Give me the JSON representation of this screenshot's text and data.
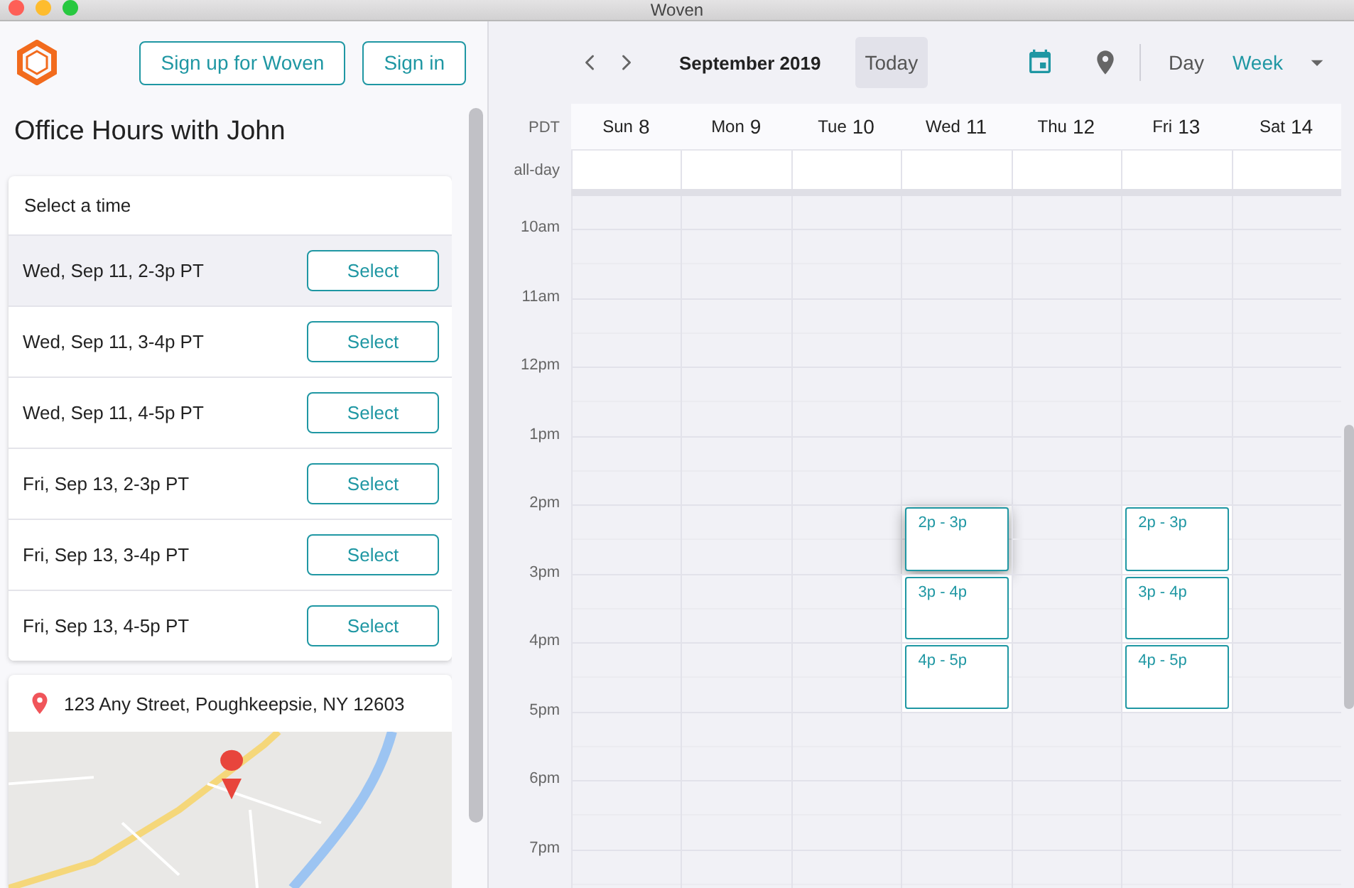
{
  "window": {
    "title": "Woven"
  },
  "header": {
    "buttons": [
      {
        "label": "Sign up for Woven"
      },
      {
        "label": "Sign in"
      }
    ]
  },
  "page_title": "Office Hours with John",
  "time_picker": {
    "heading": "Select a time",
    "slots": [
      {
        "label": "Wed, Sep 11, 2-3p PT",
        "button": "Select",
        "hovered": true
      },
      {
        "label": "Wed, Sep 11, 3-4p PT",
        "button": "Select",
        "hovered": false
      },
      {
        "label": "Wed, Sep 11, 4-5p PT",
        "button": "Select",
        "hovered": false
      },
      {
        "label": "Fri, Sep 13, 2-3p PT",
        "button": "Select",
        "hovered": false
      },
      {
        "label": "Fri, Sep 13, 3-4p PT",
        "button": "Select",
        "hovered": false
      },
      {
        "label": "Fri, Sep 13, 4-5p PT",
        "button": "Select",
        "hovered": false
      }
    ]
  },
  "location": {
    "address": "123 Any Street, Poughkeepsie, NY 12603"
  },
  "calendar": {
    "month": "September 2019",
    "today": "Today",
    "views": [
      {
        "label": "Day",
        "selected": false
      },
      {
        "label": "Week",
        "selected": true
      }
    ],
    "timezone": "PDT",
    "allday_label": "all-day",
    "days": [
      {
        "weekday": "Sun",
        "date": "8"
      },
      {
        "weekday": "Mon",
        "date": "9"
      },
      {
        "weekday": "Tue",
        "date": "10"
      },
      {
        "weekday": "Wed",
        "date": "11"
      },
      {
        "weekday": "Thu",
        "date": "12"
      },
      {
        "weekday": "Fri",
        "date": "13"
      },
      {
        "weekday": "Sat",
        "date": "14"
      }
    ],
    "hours": [
      {
        "label": "10am",
        "slots": [
          {
            "available": false
          },
          {
            "available": false
          },
          {
            "available": false
          },
          {
            "available": false
          },
          {
            "available": false
          },
          {
            "available": false
          },
          {
            "available": false
          }
        ]
      },
      {
        "label": "11am",
        "slots": [
          {
            "available": false
          },
          {
            "available": false
          },
          {
            "available": false
          },
          {
            "available": false
          },
          {
            "available": false
          },
          {
            "available": false
          },
          {
            "available": false
          }
        ]
      },
      {
        "label": "12pm",
        "slots": [
          {
            "available": false
          },
          {
            "available": false
          },
          {
            "available": false
          },
          {
            "available": false
          },
          {
            "available": false
          },
          {
            "available": false
          },
          {
            "available": false
          }
        ]
      },
      {
        "label": "1pm",
        "slots": [
          {
            "available": false
          },
          {
            "available": false
          },
          {
            "available": false
          },
          {
            "available": false
          },
          {
            "available": false
          },
          {
            "available": false
          },
          {
            "available": false
          }
        ]
      },
      {
        "label": "2pm",
        "slots": [
          {
            "available": false
          },
          {
            "available": false
          },
          {
            "available": false
          },
          {
            "available": true,
            "label": "2p - 3p",
            "hovered": true
          },
          {
            "available": false
          },
          {
            "available": true,
            "label": "2p - 3p",
            "hovered": false
          },
          {
            "available": false
          }
        ]
      },
      {
        "label": "3pm",
        "slots": [
          {
            "available": false
          },
          {
            "available": false
          },
          {
            "available": false
          },
          {
            "available": true,
            "label": "3p - 4p",
            "hovered": false
          },
          {
            "available": false
          },
          {
            "available": true,
            "label": "3p - 4p",
            "hovered": false
          },
          {
            "available": false
          }
        ]
      },
      {
        "label": "4pm",
        "slots": [
          {
            "available": false
          },
          {
            "available": false
          },
          {
            "available": false
          },
          {
            "available": true,
            "label": "4p - 5p",
            "hovered": false
          },
          {
            "available": false
          },
          {
            "available": true,
            "label": "4p - 5p",
            "hovered": false
          },
          {
            "available": false
          }
        ]
      },
      {
        "label": "5pm",
        "slots": [
          {
            "available": false
          },
          {
            "available": false
          },
          {
            "available": false
          },
          {
            "available": false
          },
          {
            "available": false
          },
          {
            "available": false
          },
          {
            "available": false
          }
        ]
      },
      {
        "label": "6pm",
        "slots": [
          {
            "available": false
          },
          {
            "available": false
          },
          {
            "available": false
          },
          {
            "available": false
          },
          {
            "available": false
          },
          {
            "available": false
          },
          {
            "available": false
          }
        ]
      },
      {
        "label": "7pm",
        "slots": [
          {
            "available": false
          },
          {
            "available": false
          },
          {
            "available": false
          },
          {
            "available": false
          },
          {
            "available": false
          },
          {
            "available": false
          },
          {
            "available": false
          }
        ]
      }
    ]
  }
}
